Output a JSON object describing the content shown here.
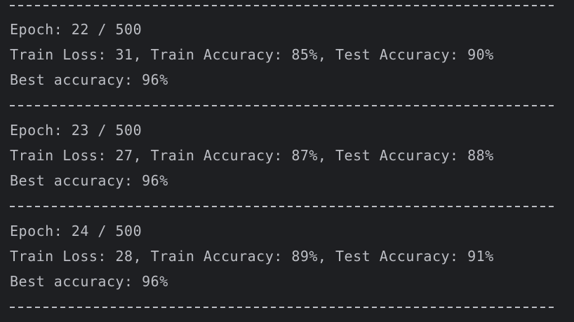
{
  "console": {
    "separator_top": "-------------------------------------------------------------",
    "blocks": [
      {
        "epoch": "Epoch: 22 / 500",
        "train": "Train Loss: 31, Train Accuracy: 85%, Test Accuracy: 90%",
        "best": "Best accuracy: 96%"
      },
      {
        "epoch": "Epoch: 23 / 500",
        "train": "Train Loss: 27, Train Accuracy: 87%, Test Accuracy: 88%",
        "best": "Best accuracy: 96%"
      },
      {
        "epoch": "Epoch: 24 / 500",
        "train": "Train Loss: 28, Train Accuracy: 89%, Test Accuracy: 91%",
        "best": "Best accuracy: 96%"
      }
    ],
    "colors": {
      "background": "#1e1f22",
      "text": "#bcbec4"
    }
  }
}
